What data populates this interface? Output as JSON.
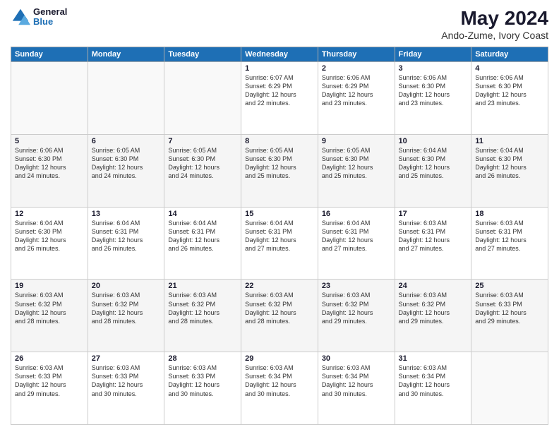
{
  "logo": {
    "general": "General",
    "blue": "Blue"
  },
  "title": "May 2024",
  "subtitle": "Ando-Zume, Ivory Coast",
  "days_of_week": [
    "Sunday",
    "Monday",
    "Tuesday",
    "Wednesday",
    "Thursday",
    "Friday",
    "Saturday"
  ],
  "weeks": [
    [
      {
        "day": "",
        "info": ""
      },
      {
        "day": "",
        "info": ""
      },
      {
        "day": "",
        "info": ""
      },
      {
        "day": "1",
        "info": "Sunrise: 6:07 AM\nSunset: 6:29 PM\nDaylight: 12 hours\nand 22 minutes."
      },
      {
        "day": "2",
        "info": "Sunrise: 6:06 AM\nSunset: 6:29 PM\nDaylight: 12 hours\nand 23 minutes."
      },
      {
        "day": "3",
        "info": "Sunrise: 6:06 AM\nSunset: 6:30 PM\nDaylight: 12 hours\nand 23 minutes."
      },
      {
        "day": "4",
        "info": "Sunrise: 6:06 AM\nSunset: 6:30 PM\nDaylight: 12 hours\nand 23 minutes."
      }
    ],
    [
      {
        "day": "5",
        "info": "Sunrise: 6:06 AM\nSunset: 6:30 PM\nDaylight: 12 hours\nand 24 minutes."
      },
      {
        "day": "6",
        "info": "Sunrise: 6:05 AM\nSunset: 6:30 PM\nDaylight: 12 hours\nand 24 minutes."
      },
      {
        "day": "7",
        "info": "Sunrise: 6:05 AM\nSunset: 6:30 PM\nDaylight: 12 hours\nand 24 minutes."
      },
      {
        "day": "8",
        "info": "Sunrise: 6:05 AM\nSunset: 6:30 PM\nDaylight: 12 hours\nand 25 minutes."
      },
      {
        "day": "9",
        "info": "Sunrise: 6:05 AM\nSunset: 6:30 PM\nDaylight: 12 hours\nand 25 minutes."
      },
      {
        "day": "10",
        "info": "Sunrise: 6:04 AM\nSunset: 6:30 PM\nDaylight: 12 hours\nand 25 minutes."
      },
      {
        "day": "11",
        "info": "Sunrise: 6:04 AM\nSunset: 6:30 PM\nDaylight: 12 hours\nand 26 minutes."
      }
    ],
    [
      {
        "day": "12",
        "info": "Sunrise: 6:04 AM\nSunset: 6:30 PM\nDaylight: 12 hours\nand 26 minutes."
      },
      {
        "day": "13",
        "info": "Sunrise: 6:04 AM\nSunset: 6:31 PM\nDaylight: 12 hours\nand 26 minutes."
      },
      {
        "day": "14",
        "info": "Sunrise: 6:04 AM\nSunset: 6:31 PM\nDaylight: 12 hours\nand 26 minutes."
      },
      {
        "day": "15",
        "info": "Sunrise: 6:04 AM\nSunset: 6:31 PM\nDaylight: 12 hours\nand 27 minutes."
      },
      {
        "day": "16",
        "info": "Sunrise: 6:04 AM\nSunset: 6:31 PM\nDaylight: 12 hours\nand 27 minutes."
      },
      {
        "day": "17",
        "info": "Sunrise: 6:03 AM\nSunset: 6:31 PM\nDaylight: 12 hours\nand 27 minutes."
      },
      {
        "day": "18",
        "info": "Sunrise: 6:03 AM\nSunset: 6:31 PM\nDaylight: 12 hours\nand 27 minutes."
      }
    ],
    [
      {
        "day": "19",
        "info": "Sunrise: 6:03 AM\nSunset: 6:32 PM\nDaylight: 12 hours\nand 28 minutes."
      },
      {
        "day": "20",
        "info": "Sunrise: 6:03 AM\nSunset: 6:32 PM\nDaylight: 12 hours\nand 28 minutes."
      },
      {
        "day": "21",
        "info": "Sunrise: 6:03 AM\nSunset: 6:32 PM\nDaylight: 12 hours\nand 28 minutes."
      },
      {
        "day": "22",
        "info": "Sunrise: 6:03 AM\nSunset: 6:32 PM\nDaylight: 12 hours\nand 28 minutes."
      },
      {
        "day": "23",
        "info": "Sunrise: 6:03 AM\nSunset: 6:32 PM\nDaylight: 12 hours\nand 29 minutes."
      },
      {
        "day": "24",
        "info": "Sunrise: 6:03 AM\nSunset: 6:32 PM\nDaylight: 12 hours\nand 29 minutes."
      },
      {
        "day": "25",
        "info": "Sunrise: 6:03 AM\nSunset: 6:33 PM\nDaylight: 12 hours\nand 29 minutes."
      }
    ],
    [
      {
        "day": "26",
        "info": "Sunrise: 6:03 AM\nSunset: 6:33 PM\nDaylight: 12 hours\nand 29 minutes."
      },
      {
        "day": "27",
        "info": "Sunrise: 6:03 AM\nSunset: 6:33 PM\nDaylight: 12 hours\nand 30 minutes."
      },
      {
        "day": "28",
        "info": "Sunrise: 6:03 AM\nSunset: 6:33 PM\nDaylight: 12 hours\nand 30 minutes."
      },
      {
        "day": "29",
        "info": "Sunrise: 6:03 AM\nSunset: 6:34 PM\nDaylight: 12 hours\nand 30 minutes."
      },
      {
        "day": "30",
        "info": "Sunrise: 6:03 AM\nSunset: 6:34 PM\nDaylight: 12 hours\nand 30 minutes."
      },
      {
        "day": "31",
        "info": "Sunrise: 6:03 AM\nSunset: 6:34 PM\nDaylight: 12 hours\nand 30 minutes."
      },
      {
        "day": "",
        "info": ""
      }
    ]
  ]
}
